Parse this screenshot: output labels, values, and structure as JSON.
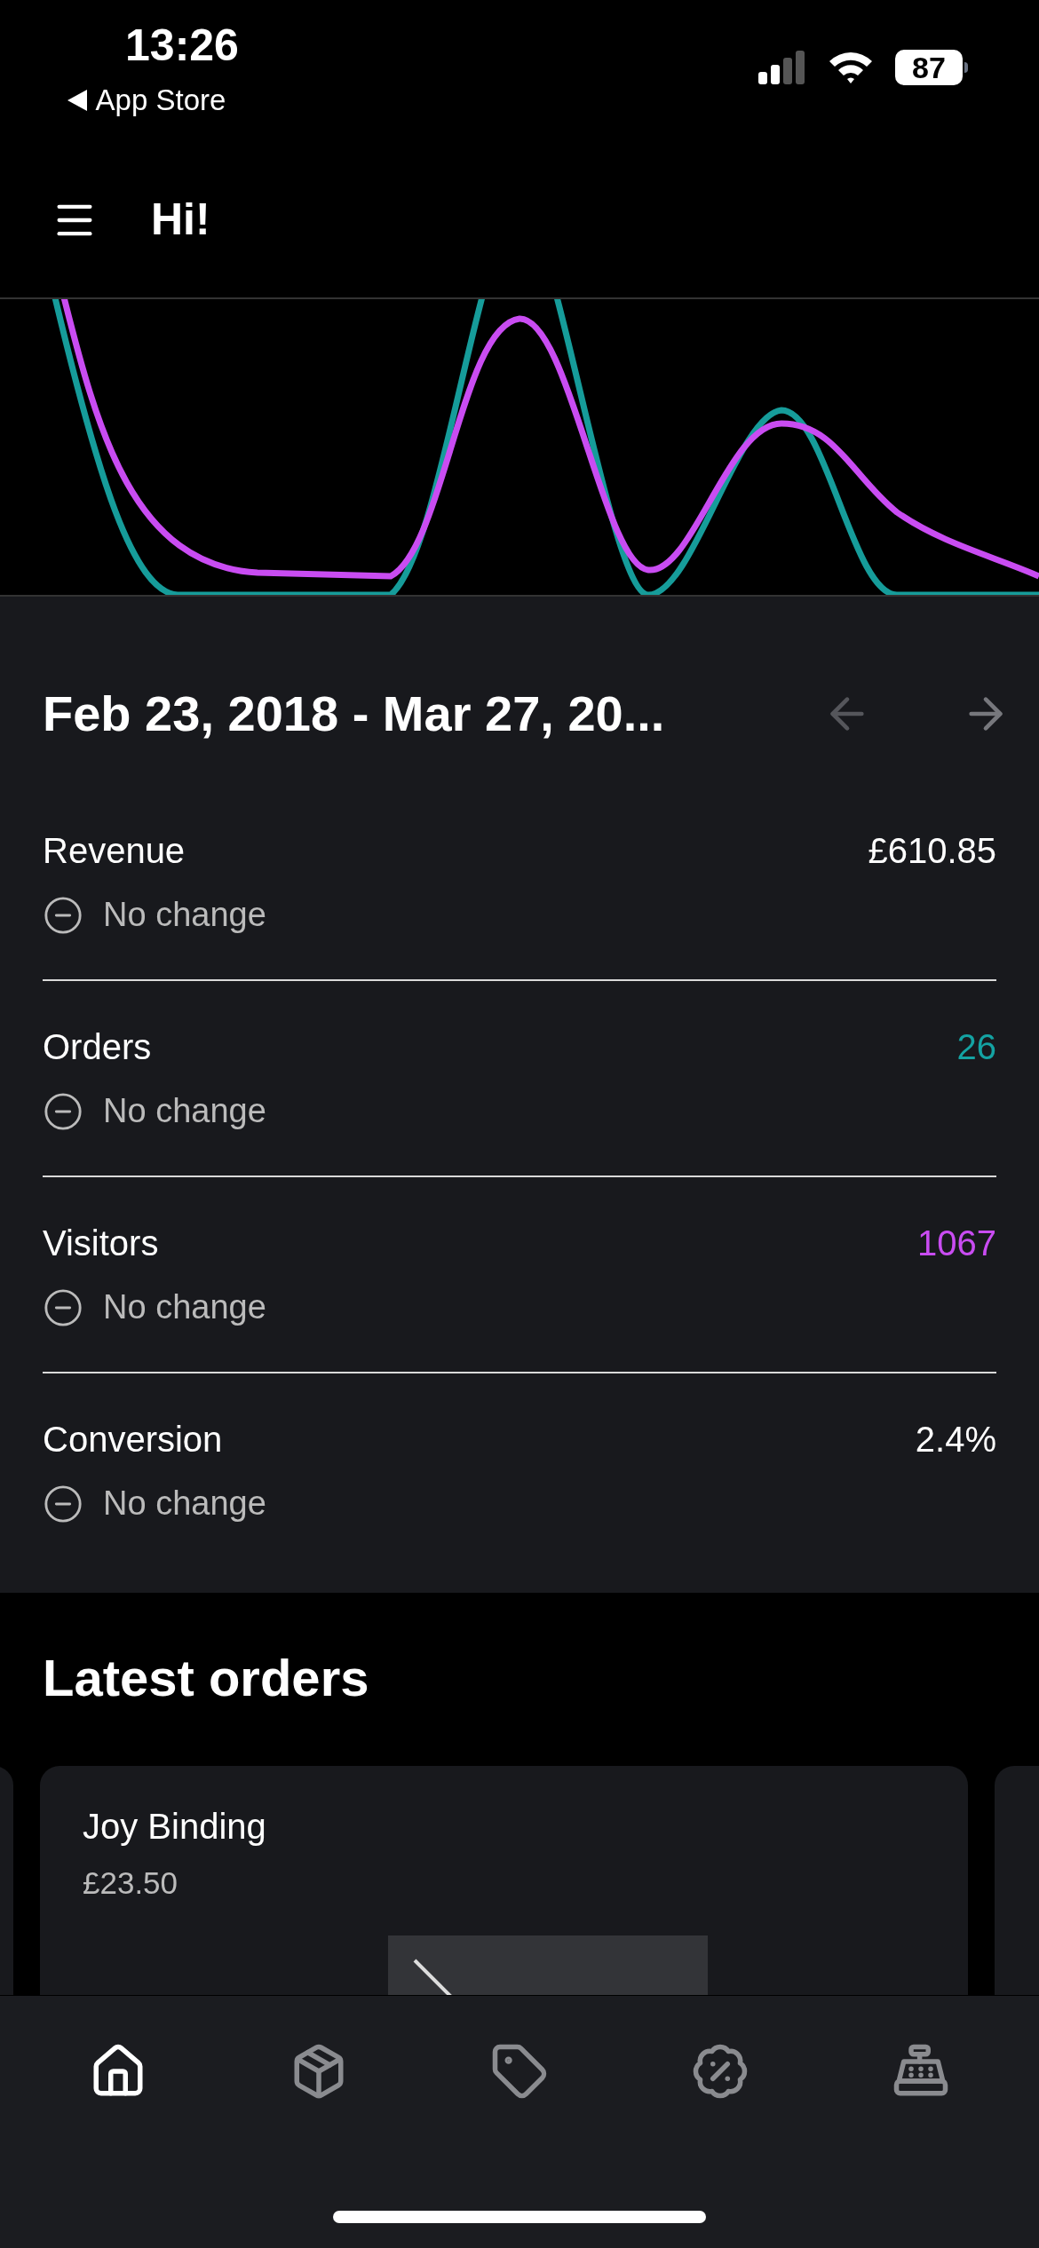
{
  "status_bar": {
    "time": "13:26",
    "back_label": "App Store",
    "battery": "87"
  },
  "header": {
    "title": "Hi!"
  },
  "summary": {
    "date_range": "Feb 23, 2018 - Mar 27, 20...",
    "stats": [
      {
        "label": "Revenue",
        "value": "£610.85",
        "color": "#ffffff",
        "change": "No change"
      },
      {
        "label": "Orders",
        "value": "26",
        "color": "#14a3a3",
        "change": "No change"
      },
      {
        "label": "Visitors",
        "value": "1067",
        "color": "#c94cf2",
        "change": "No change"
      },
      {
        "label": "Conversion",
        "value": "2.4%",
        "color": "#ffffff",
        "change": "No change"
      }
    ]
  },
  "latest_orders": {
    "title": "Latest orders",
    "orders": [
      {
        "customer": "Joy Binding",
        "total": "£23.50"
      }
    ]
  },
  "tab_bar": [
    {
      "kind": "home",
      "selected": true
    },
    {
      "kind": "box",
      "selected": false
    },
    {
      "kind": "tag",
      "selected": false
    },
    {
      "kind": "discount",
      "selected": false
    },
    {
      "kind": "register",
      "selected": false
    }
  ]
}
